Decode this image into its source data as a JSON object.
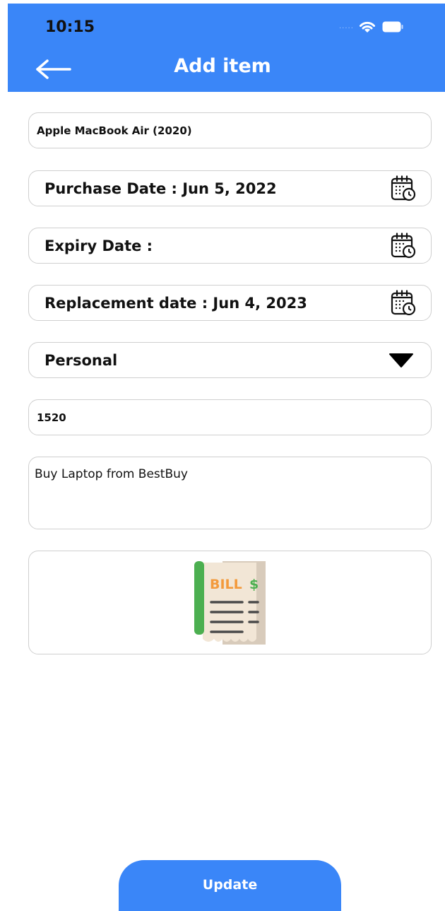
{
  "status_bar": {
    "time": "10:15",
    "signal": "....."
  },
  "header": {
    "title": "Add item"
  },
  "form": {
    "item_name": "Apple MacBook Air (2020)",
    "purchase_date": "Purchase Date : Jun 5, 2022",
    "expiry_date": "Expiry Date :",
    "replacement_date": "Replacement date : Jun 4, 2023",
    "category": "Personal",
    "price": "1520",
    "note": "Buy Laptop from BestBuy",
    "bill": {
      "label": "BILL",
      "currency": "$"
    }
  },
  "actions": {
    "update_label": "Update"
  },
  "icons": {
    "back": "arrow-left-icon",
    "calendar": "calendar-clock-icon",
    "dropdown": "triangle-down-icon",
    "bill": "bill-receipt-icon",
    "wifi": "wifi-icon",
    "battery": "battery-icon"
  },
  "colors": {
    "accent": "#3a86f8",
    "border": "#cfcfcf"
  }
}
